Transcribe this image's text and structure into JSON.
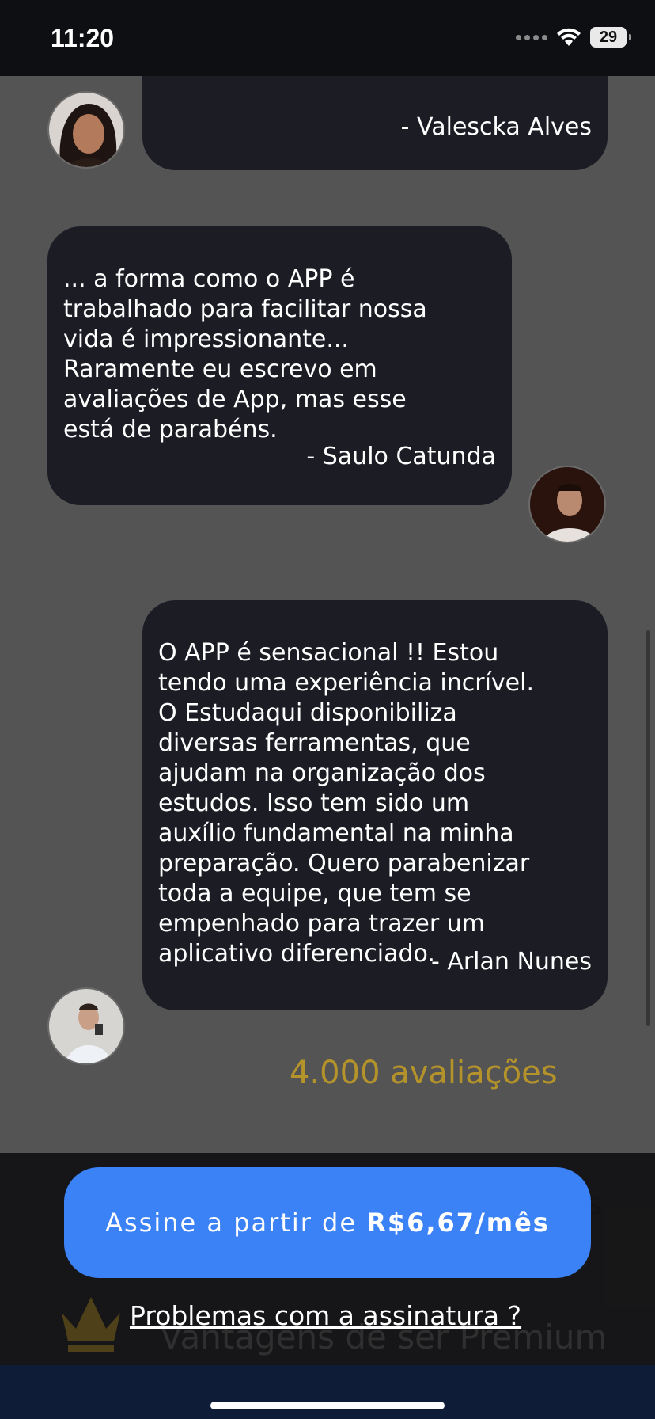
{
  "status_bar": {
    "time": "11:20",
    "battery": "29"
  },
  "testimonials": [
    {
      "quote": "",
      "author": "- Valescka Alves"
    },
    {
      "quote": "... a forma como o APP é\ntrabalhado para facilitar nossa\nvida é impressionante...\nRaramente eu escrevo em\navaliações de App, mas esse\nestá de parabéns.",
      "author": "- Saulo Catunda"
    },
    {
      "quote": "O APP é sensacional !! Estou\ntendo uma experiência incrível.\nO Estudaqui disponibiliza\ndiversas ferramentas, que\najudam na organização dos\nestudos. Isso tem sido um\nauxílio fundamental na minha\npreparação. Quero parabenizar\ntoda a equipe, que tem se\nempenhado para trazer um\naplicativo diferenciado.",
      "author": "- Arlan Nunes"
    }
  ],
  "ratings_peek": "4.000 avaliações",
  "cta": {
    "prefix": "Assine a partir de ",
    "price": "R$6,67/mês"
  },
  "premium_title": "Vantagens de ser Premium",
  "problems_link": "Problemas com a assinatura ?",
  "colors": {
    "background": "#545454",
    "bubble": "#1b1c24",
    "cta": "#3b82f6",
    "gold": "#b5932b",
    "home_bar": "#0e1c38"
  },
  "icons": [
    "wifi-icon",
    "battery-icon",
    "crown-icon"
  ]
}
